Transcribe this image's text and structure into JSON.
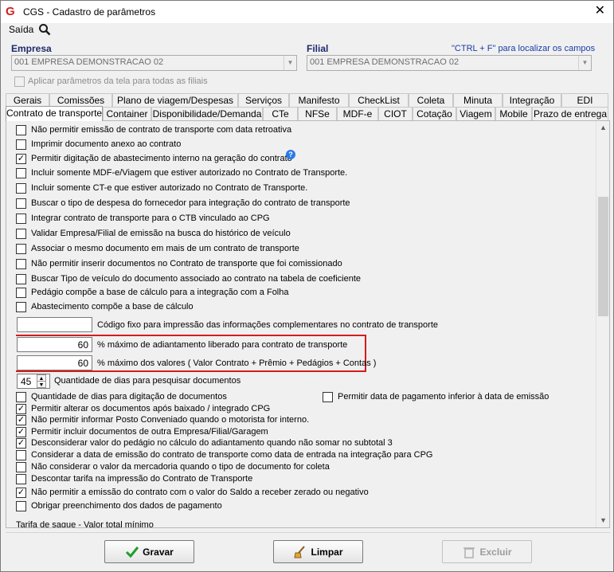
{
  "window": {
    "title": "CGS - Cadastro de parâmetros",
    "close": "✕"
  },
  "menu": {
    "saida": "Saída"
  },
  "empresa": {
    "label": "Empresa",
    "value": "001 EMPRESA DEMONSTRACAO 02"
  },
  "filial": {
    "label": "Filial",
    "value": "001 EMPRESA DEMONSTRACAO 02",
    "hint": "\"CTRL + F\" para localizar os campos"
  },
  "apply_all": {
    "label": "Aplicar parâmetros da tela para todas as filiais",
    "checked": false
  },
  "tabs_row1": [
    "Gerais",
    "Comissões",
    "Plano de viagem/Despesas",
    "Serviços",
    "Manifesto",
    "CheckList",
    "Coleta",
    "Minuta",
    "Integração",
    "EDI"
  ],
  "tabs_row2": [
    "Contrato de transporte",
    "Container",
    "Disponibilidade/Demanda",
    "CTe",
    "NFSe",
    "MDF-e",
    "CIOT",
    "Cotação",
    "Viagem",
    "Mobile",
    "Prazo de entrega"
  ],
  "active_tab": "Contrato de transporte",
  "options_top": [
    {
      "label": "Não permitir emissão de contrato de transporte com data retroativa",
      "checked": false
    },
    {
      "label": "Imprimir documento anexo ao contrato",
      "checked": false
    },
    {
      "label": "Permitir digitação de abastecimento interno na geração do contrato",
      "checked": true
    },
    {
      "label": "Incluir somente MDF-e/Viagem que estiver autorizado no Contrato de Transporte.",
      "checked": false
    },
    {
      "label": "Incluir somente CT-e que estiver autorizado no Contrato de Transporte.",
      "checked": false
    },
    {
      "label": "Buscar o tipo de despesa do fornecedor para integração do contrato de transporte",
      "checked": false
    },
    {
      "label": "Integrar contrato de transporte para o CTB vinculado ao CPG",
      "checked": false
    },
    {
      "label": "Validar Empresa/Filial de emissão na busca do histórico de veículo",
      "checked": false
    },
    {
      "label": "Associar o mesmo documento em mais de um contrato de transporte",
      "checked": false
    },
    {
      "label": "Não permitir inserir documentos no Contrato de transporte que foi comissionado",
      "checked": false
    },
    {
      "label": "Buscar Tipo de veículo do documento associado ao contrato na tabela de coeficiente",
      "checked": false
    },
    {
      "label": "Pedágio compõe a base de cálculo para a integração com a Folha",
      "checked": false
    },
    {
      "label": "Abastecimento compõe a base de cálculo",
      "checked": false
    }
  ],
  "help_icon": "?",
  "codigo_fixo": {
    "label": "Código fixo para impressão das informações complementares no contrato de transporte",
    "value": ""
  },
  "adiantamento": {
    "label": "% máximo de adiantamento liberado para contrato de transporte",
    "value": "60"
  },
  "maximo_valores": {
    "label": "% máximo dos valores ( Valor Contrato + Prêmio + Pedágios + Contas )",
    "value": "60"
  },
  "dias_pesquisa": {
    "label": "Quantidade de dias para pesquisar documentos",
    "value": "45"
  },
  "options_bottom": [
    {
      "label": "Quantidade de dias para digitação de documentos",
      "checked": false
    },
    {
      "label": "Permitir alterar os documentos após baixado / integrado CPG",
      "checked": true
    },
    {
      "label": "Não permitir informar Posto Conveniado quando o motorista for interno.",
      "checked": true
    },
    {
      "label": "Permitir incluir documentos de outra Empresa/Filial/Garagem",
      "checked": true
    },
    {
      "label": "Desconsiderar valor do pedágio no cálculo do adiantamento quando não somar no subtotal 3",
      "checked": true
    },
    {
      "label": "Considerar a data de emissão do contrato de transporte como data de entrada na integração para CPG",
      "checked": false
    },
    {
      "label": "Não considerar o valor da mercadoria quando o tipo de documento for coleta",
      "checked": false
    },
    {
      "label": "Descontar tarifa na impressão do Contrato de Transporte",
      "checked": false
    },
    {
      "label": "Não permitir a emissão do contrato com o valor do Saldo a receber zerado ou negativo",
      "checked": true
    },
    {
      "label": "Obrigar preenchimento dos dados de pagamento",
      "checked": false
    }
  ],
  "data_pagamento": {
    "label": "Permitir data de pagamento inferior à data de emissão",
    "checked": false
  },
  "tarifa_saque": {
    "label": "Tarifa de saque - Valor total mínimo"
  },
  "buttons": {
    "gravar": "Gravar",
    "limpar": "Limpar",
    "excluir": "Excluir"
  },
  "colors": {
    "highlight": "#d41c1c",
    "hint": "#1a3ca8",
    "check_green": "#1e9e2a"
  }
}
